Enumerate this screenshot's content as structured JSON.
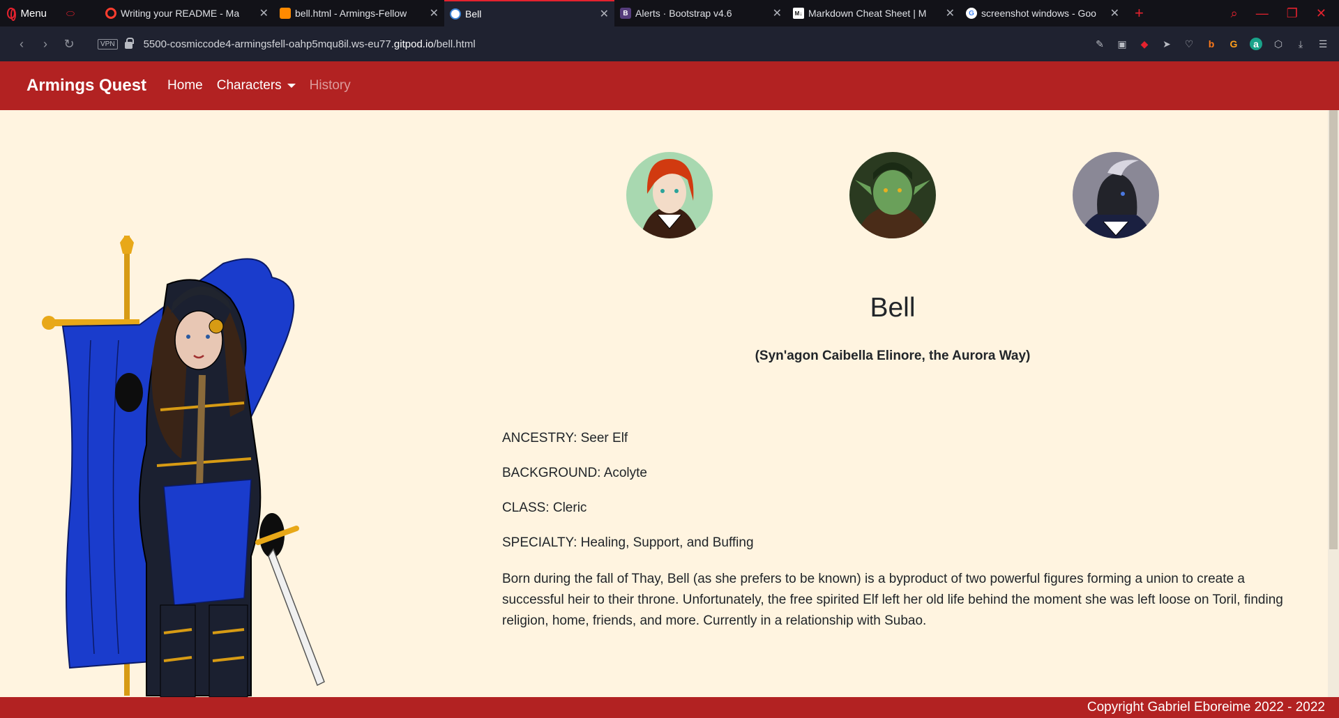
{
  "browser": {
    "menu_label": "Menu",
    "tabs": [
      {
        "title": "Writing your README - Ma",
        "favicon": "opera-icon"
      },
      {
        "title": "bell.html - Armings-Fellow",
        "favicon": "gitpod-icon"
      },
      {
        "title": "Bell",
        "favicon": "globe-icon"
      },
      {
        "title": "Alerts · Bootstrap v4.6",
        "favicon": "bootstrap-icon"
      },
      {
        "title": "Markdown Cheat Sheet | M",
        "favicon": "markdown-icon"
      },
      {
        "title": "screenshot windows - Goo",
        "favicon": "google-icon"
      }
    ],
    "vpn_label": "VPN",
    "url_prefix": "5500-cosmiccode4-armingsfell-oahp5mqu8il.ws-eu77.",
    "url_domain": "gitpod.io",
    "url_path": "/bell.html",
    "accent_color": "#e5222e"
  },
  "site": {
    "brand": "Armings Quest",
    "nav": {
      "home": "Home",
      "characters": "Characters",
      "history": "History"
    },
    "nav_color": "#b22222",
    "background": "#fff4e0"
  },
  "character": {
    "name": "Bell",
    "subtitle": "(Syn'agon Caibella Elinore, the Aurora Way)",
    "ancestry": "ANCESTRY: Seer Elf",
    "background": "BACKGROUND: Acolyte",
    "class": "CLASS: Cleric",
    "specialty": "SPECIALTY: Healing, Support, and Buffing",
    "bio": "Born during the fall of Thay, Bell (as she prefers to be known) is a byproduct of two powerful figures forming a union to create a successful heir to their throne. Unfortunately, the free spirited Elf left her old life behind the moment she was left loose on Toril, finding religion, home, friends, and more. Currently in a relationship with Subao."
  },
  "footer": {
    "copyright": "Copyright Gabriel Eboreime 2022 - 2022"
  }
}
